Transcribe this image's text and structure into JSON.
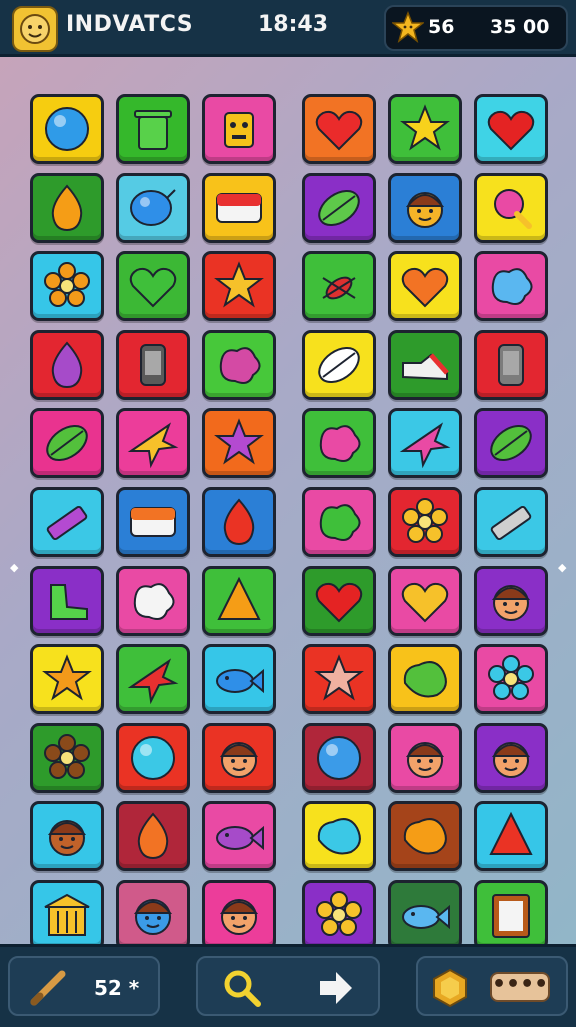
{
  "header": {
    "title": "INDVATCS",
    "time": "18:43",
    "currency_left": "56",
    "currency_right": "35 00",
    "avatar_icon": "smiley-avatar-icon",
    "badge_icon": "star-character-icon"
  },
  "board": {
    "rows": 11,
    "cols": 6,
    "tiles": [
      {
        "bg": "#f6cd10",
        "icon": "circle",
        "fg": "#2f9be8"
      },
      {
        "bg": "#35b82b",
        "icon": "bin",
        "fg": "#58d14a"
      },
      {
        "bg": "#e94aa4",
        "icon": "robot",
        "fg": "#f4c21a"
      },
      {
        "bg": "#f27324",
        "icon": "heart",
        "fg": "#ea2b2b"
      },
      {
        "bg": "#3fbf3a",
        "icon": "star",
        "fg": "#f7d21c"
      },
      {
        "bg": "#3fd3e6",
        "icon": "heart",
        "fg": "#e42323"
      },
      {
        "bg": "#2e9b2b",
        "icon": "drop",
        "fg": "#f59d16"
      },
      {
        "bg": "#55cbe4",
        "icon": "balloon",
        "fg": "#2f8fe8"
      },
      {
        "bg": "#f8c21a",
        "icon": "card",
        "fg": "#e83030"
      },
      {
        "bg": "#8a2fc7",
        "icon": "leaf",
        "fg": "#5ec94a"
      },
      {
        "bg": "#2b7fd6",
        "icon": "face",
        "fg": "#f4b428"
      },
      {
        "bg": "#f7e11d",
        "icon": "pin",
        "fg": "#e94aa4"
      },
      {
        "bg": "#36c6e8",
        "icon": "flower",
        "fg": "#f39a1a"
      },
      {
        "bg": "#3cb835",
        "icon": "heart",
        "fg": "#3fbf3a"
      },
      {
        "bg": "#ea3324",
        "icon": "star",
        "fg": "#f6c12a"
      },
      {
        "bg": "#3fbf3a",
        "icon": "bug",
        "fg": "#dc3030"
      },
      {
        "bg": "#f7e11d",
        "icon": "heart",
        "fg": "#f27324"
      },
      {
        "bg": "#e94aa4",
        "icon": "splat",
        "fg": "#5ab7f0"
      },
      {
        "bg": "#e32630",
        "icon": "drop",
        "fg": "#a64bc9"
      },
      {
        "bg": "#e32630",
        "icon": "phone",
        "fg": "#5a5a5a"
      },
      {
        "bg": "#47c83a",
        "icon": "splat",
        "fg": "#d44aa4"
      },
      {
        "bg": "#f7e11d",
        "icon": "leaf",
        "fg": "#ffffff"
      },
      {
        "bg": "#2e9b2b",
        "icon": "shoe",
        "fg": "#f0f0f0"
      },
      {
        "bg": "#e32630",
        "icon": "phone",
        "fg": "#7c7c7c"
      },
      {
        "bg": "#e9338f",
        "icon": "leaf",
        "fg": "#53c03c"
      },
      {
        "bg": "#ec3d9a",
        "icon": "plane",
        "fg": "#f6c12a"
      },
      {
        "bg": "#f26a1c",
        "icon": "star",
        "fg": "#b44ad1"
      },
      {
        "bg": "#3fbf3a",
        "icon": "splat",
        "fg": "#e94aa4"
      },
      {
        "bg": "#3bc8e6",
        "icon": "plane",
        "fg": "#e94aa4"
      },
      {
        "bg": "#8a2fc7",
        "icon": "leaf",
        "fg": "#53c03c"
      },
      {
        "bg": "#3bc8e6",
        "icon": "pencil",
        "fg": "#b44ad1"
      },
      {
        "bg": "#2b7fd6",
        "icon": "card",
        "fg": "#f27324"
      },
      {
        "bg": "#2b7fd6",
        "icon": "drop",
        "fg": "#ea3324"
      },
      {
        "bg": "#e94aa4",
        "icon": "splat",
        "fg": "#3fbf3a"
      },
      {
        "bg": "#e32630",
        "icon": "flower",
        "fg": "#f6c12a"
      },
      {
        "bg": "#3bc8e6",
        "icon": "pencil",
        "fg": "#cfcfcf"
      },
      {
        "bg": "#8a2fc7",
        "icon": "boot",
        "fg": "#55d44a"
      },
      {
        "bg": "#e94aa4",
        "icon": "splat",
        "fg": "#f4f4f4"
      },
      {
        "bg": "#3fbf3a",
        "icon": "cone",
        "fg": "#f59d16"
      },
      {
        "bg": "#2e9b2b",
        "icon": "heart",
        "fg": "#e42323"
      },
      {
        "bg": "#e94aa4",
        "icon": "heart",
        "fg": "#f6c12a"
      },
      {
        "bg": "#8a2fc7",
        "icon": "face",
        "fg": "#f2a26a"
      },
      {
        "bg": "#f7e11d",
        "icon": "star",
        "fg": "#f39a1a"
      },
      {
        "bg": "#3fbf3a",
        "icon": "plane",
        "fg": "#e83030"
      },
      {
        "bg": "#36c6e8",
        "icon": "fish",
        "fg": "#2f8fe8"
      },
      {
        "bg": "#ea3324",
        "icon": "star",
        "fg": "#f0b0a0"
      },
      {
        "bg": "#f8c21a",
        "icon": "blob",
        "fg": "#53c03c"
      },
      {
        "bg": "#e94aa4",
        "icon": "flower",
        "fg": "#3bc8e6"
      },
      {
        "bg": "#2e9b2b",
        "icon": "flower",
        "fg": "#8a4a1a"
      },
      {
        "bg": "#ea3324",
        "icon": "circle",
        "fg": "#3bc8e6"
      },
      {
        "bg": "#ea3324",
        "icon": "face",
        "fg": "#f2a26a"
      },
      {
        "bg": "#b0263a",
        "icon": "circle",
        "fg": "#3b9be8"
      },
      {
        "bg": "#e94aa4",
        "icon": "face",
        "fg": "#f2a26a"
      },
      {
        "bg": "#8a2fc7",
        "icon": "face",
        "fg": "#f2a26a"
      },
      {
        "bg": "#36c6e8",
        "icon": "face",
        "fg": "#c0622a"
      },
      {
        "bg": "#b0263a",
        "icon": "drop",
        "fg": "#f27324"
      },
      {
        "bg": "#e94aa4",
        "icon": "fish",
        "fg": "#a64bc9"
      },
      {
        "bg": "#f7e11d",
        "icon": "blob",
        "fg": "#3bc8e6"
      },
      {
        "bg": "#a5441a",
        "icon": "blob",
        "fg": "#f59d16"
      },
      {
        "bg": "#36c6e8",
        "icon": "cone",
        "fg": "#ea3324"
      },
      {
        "bg": "#36c6e8",
        "icon": "building",
        "fg": "#f6c12a"
      },
      {
        "bg": "#d05a8a",
        "icon": "face",
        "fg": "#3b9be8"
      },
      {
        "bg": "#ec3d9a",
        "icon": "face",
        "fg": "#f2a26a"
      },
      {
        "bg": "#8a2fc7",
        "icon": "flower",
        "fg": "#f6c12a"
      },
      {
        "bg": "#2e7a3a",
        "icon": "fish",
        "fg": "#5ab7f0"
      },
      {
        "bg": "#3fbf3a",
        "icon": "frame",
        "fg": "#b85a1a"
      }
    ]
  },
  "footer": {
    "moves_label": "52 *",
    "dots_label": "••••",
    "bat_icon": "bat-icon",
    "search_icon": "search-icon",
    "arrow_icon": "arrow-right-icon",
    "coin_icon": "coin-icon"
  }
}
